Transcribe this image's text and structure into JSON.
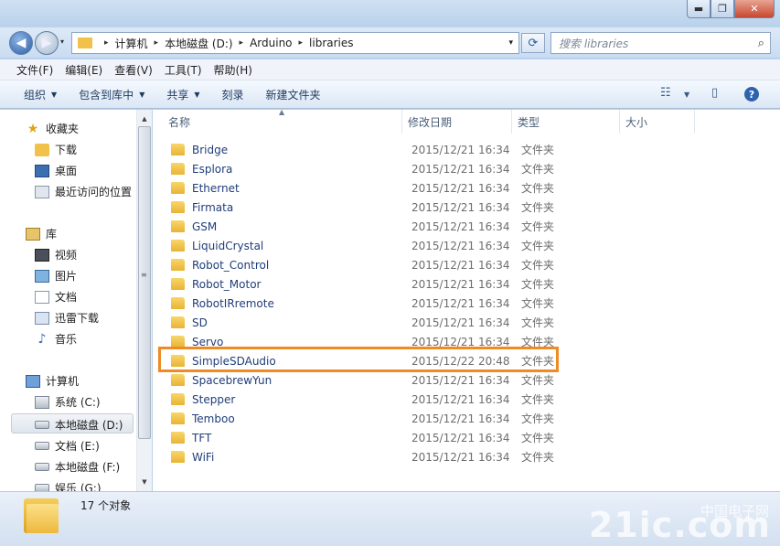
{
  "window": {
    "controls": {
      "minimize": "▬",
      "maximize": "❐",
      "close": "✕"
    }
  },
  "address": {
    "crumbs": [
      "计算机",
      "本地磁盘 (D:)",
      "Arduino",
      "libraries"
    ],
    "separator": "▸",
    "dropdown_glyph": "▾",
    "refresh_glyph": "⟳"
  },
  "search": {
    "placeholder": "搜索 libraries",
    "icon": "search-icon",
    "icon_glyph": "⌕"
  },
  "menu": [
    "文件(F)",
    "编辑(E)",
    "查看(V)",
    "工具(T)",
    "帮助(H)"
  ],
  "toolbar": {
    "organize": "组织",
    "include_in_library": "包含到库中",
    "share": "共享",
    "burn": "刻录",
    "new_folder": "新建文件夹",
    "dropdown_glyph": "▼",
    "view_glyph": "☷",
    "view_dd_glyph": "▼",
    "preview_glyph": "▯",
    "help_glyph": "?"
  },
  "nav": {
    "favorites": {
      "label": "收藏夹",
      "items": [
        "下载",
        "桌面",
        "最近访问的位置"
      ]
    },
    "libraries": {
      "label": "库",
      "items": [
        "视频",
        "图片",
        "文档",
        "迅雷下载",
        "音乐"
      ]
    },
    "computer": {
      "label": "计算机",
      "items": [
        "系统 (C:)",
        "本地磁盘 (D:)",
        "文档 (E:)",
        "本地磁盘 (F:)",
        "娱乐 (G:)"
      ],
      "selected": "本地磁盘 (D:)"
    }
  },
  "columns": {
    "name": "名称",
    "modified": "修改日期",
    "type": "类型",
    "size": "大小",
    "sort_glyph": "▲"
  },
  "files": [
    {
      "name": "Bridge",
      "modified": "2015/12/21 16:34",
      "type": "文件夹"
    },
    {
      "name": "Esplora",
      "modified": "2015/12/21 16:34",
      "type": "文件夹"
    },
    {
      "name": "Ethernet",
      "modified": "2015/12/21 16:34",
      "type": "文件夹"
    },
    {
      "name": "Firmata",
      "modified": "2015/12/21 16:34",
      "type": "文件夹"
    },
    {
      "name": "GSM",
      "modified": "2015/12/21 16:34",
      "type": "文件夹"
    },
    {
      "name": "LiquidCrystal",
      "modified": "2015/12/21 16:34",
      "type": "文件夹"
    },
    {
      "name": "Robot_Control",
      "modified": "2015/12/21 16:34",
      "type": "文件夹"
    },
    {
      "name": "Robot_Motor",
      "modified": "2015/12/21 16:34",
      "type": "文件夹"
    },
    {
      "name": "RobotIRremote",
      "modified": "2015/12/21 16:34",
      "type": "文件夹"
    },
    {
      "name": "SD",
      "modified": "2015/12/21 16:34",
      "type": "文件夹"
    },
    {
      "name": "Servo",
      "modified": "2015/12/21 16:34",
      "type": "文件夹"
    },
    {
      "name": "SimpleSDAudio",
      "modified": "2015/12/22 20:48",
      "type": "文件夹"
    },
    {
      "name": "SpacebrewYun",
      "modified": "2015/12/21 16:34",
      "type": "文件夹"
    },
    {
      "name": "Stepper",
      "modified": "2015/12/21 16:34",
      "type": "文件夹"
    },
    {
      "name": "Temboo",
      "modified": "2015/12/21 16:34",
      "type": "文件夹"
    },
    {
      "name": "TFT",
      "modified": "2015/12/21 16:34",
      "type": "文件夹"
    },
    {
      "name": "WiFi",
      "modified": "2015/12/21 16:34",
      "type": "文件夹"
    }
  ],
  "highlighted_file": "SimpleSDAudio",
  "status": {
    "count": "17 个对象"
  },
  "watermark": {
    "main": "21ic.com",
    "sub": "中国电子网"
  },
  "colors": {
    "highlight_border": "#f08a24",
    "folder": "#f2c14a",
    "link_text": "#1f3d7a"
  }
}
